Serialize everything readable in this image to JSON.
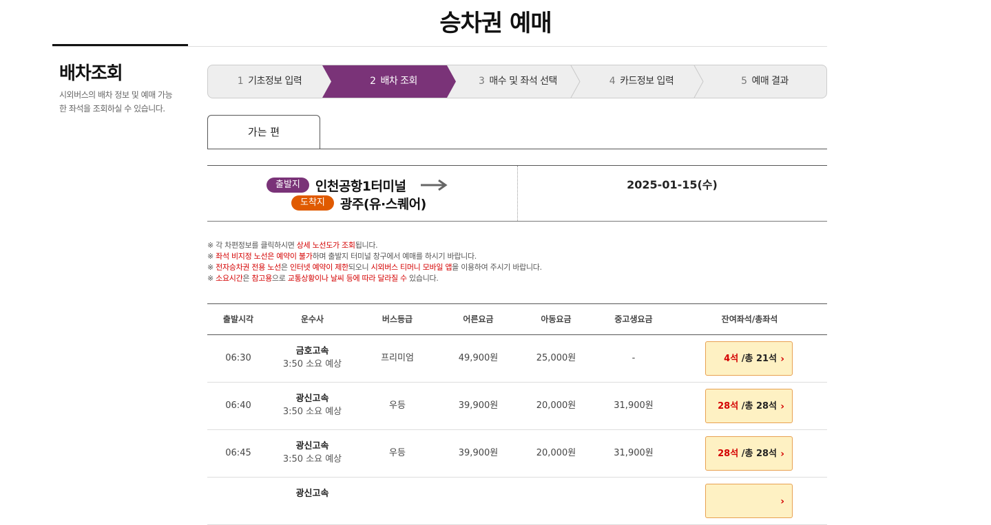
{
  "page": {
    "title": "승차권 예매"
  },
  "sidebar": {
    "title": "배차조회",
    "description": "시외버스의 배차 정보 및 예매 가능한 좌석을 조회하실 수 있습니다."
  },
  "steps": [
    {
      "num": "1",
      "label": "기초정보 입력",
      "active": false
    },
    {
      "num": "2",
      "label": "배차 조회",
      "active": true
    },
    {
      "num": "3",
      "label": "매수 및 좌석 선택",
      "active": false
    },
    {
      "num": "4",
      "label": "카드정보 입력",
      "active": false
    },
    {
      "num": "5",
      "label": "예매 결과",
      "active": false
    }
  ],
  "tab": {
    "label": "가는 편"
  },
  "route": {
    "depart_badge": "출발지",
    "depart": "인천공항1터미널",
    "arrive_badge": "도착지",
    "arrive": "광주(유·스퀘어)",
    "date": "2025-01-15(수)"
  },
  "notices": [
    [
      {
        "t": "※ 각 차편정보를 클릭하시면 ",
        "red": false
      },
      {
        "t": "상세 노선도가 조회",
        "red": true
      },
      {
        "t": "됩니다.",
        "red": false
      }
    ],
    [
      {
        "t": "※ ",
        "red": false
      },
      {
        "t": "좌석 비지정 노선은 예약이 불가",
        "red": true
      },
      {
        "t": "하며 출발지 터미널 창구에서 예매를 하시기 바랍니다.",
        "red": false
      }
    ],
    [
      {
        "t": "※ ",
        "red": false
      },
      {
        "t": "전자승차권 전용 노선",
        "red": true
      },
      {
        "t": "은 ",
        "red": false
      },
      {
        "t": "인터넷 예약이 제한",
        "red": true
      },
      {
        "t": "되오니 ",
        "red": false
      },
      {
        "t": "시외버스 티머니 모바일 앱",
        "red": true
      },
      {
        "t": "을 이용하여 주시기 바랍니다.",
        "red": false
      }
    ],
    [
      {
        "t": "※ ",
        "red": false
      },
      {
        "t": "소요시간",
        "red": true
      },
      {
        "t": "은 ",
        "red": false
      },
      {
        "t": "참고용",
        "red": true
      },
      {
        "t": "으로 ",
        "red": false
      },
      {
        "t": "교통상황이나 날씨 등에 따라 달라질 수",
        "red": true
      },
      {
        "t": " 있습니다.",
        "red": false
      }
    ]
  ],
  "table": {
    "headers": [
      "출발시각",
      "운수사",
      "버스등급",
      "어른요금",
      "아동요금",
      "중고생요금",
      "잔여좌석/총좌석"
    ],
    "rows": [
      {
        "time": "06:30",
        "company": "금호고속",
        "duration": "3:50 소요 예상",
        "grade": "프리미엄",
        "adult": "49,900원",
        "child": "25,000원",
        "student": "-",
        "seats": "4석",
        "total": " /총 21석"
      },
      {
        "time": "06:40",
        "company": "광신고속",
        "duration": "3:50 소요 예상",
        "grade": "우등",
        "adult": "39,900원",
        "child": "20,000원",
        "student": "31,900원",
        "seats": "28석",
        "total": " /총 28석"
      },
      {
        "time": "06:45",
        "company": "광신고속",
        "duration": "3:50 소요 예상",
        "grade": "우등",
        "adult": "39,900원",
        "child": "20,000원",
        "student": "31,900원",
        "seats": "28석",
        "total": " /총 28석"
      },
      {
        "time": "",
        "company": "광신고속",
        "duration": "",
        "grade": "",
        "adult": "",
        "child": "",
        "student": "",
        "seats": "",
        "total": ""
      }
    ]
  },
  "colors": {
    "step_active": "#7a3378",
    "depart_badge": "#7a3378",
    "arrive_badge": "#e05a00",
    "accent_red": "#d40000",
    "seat_button_bg": "#fef1c3"
  },
  "icons": {
    "route_arrow": "arrow-right-icon",
    "seat_chevron": "chevron-right-icon"
  }
}
